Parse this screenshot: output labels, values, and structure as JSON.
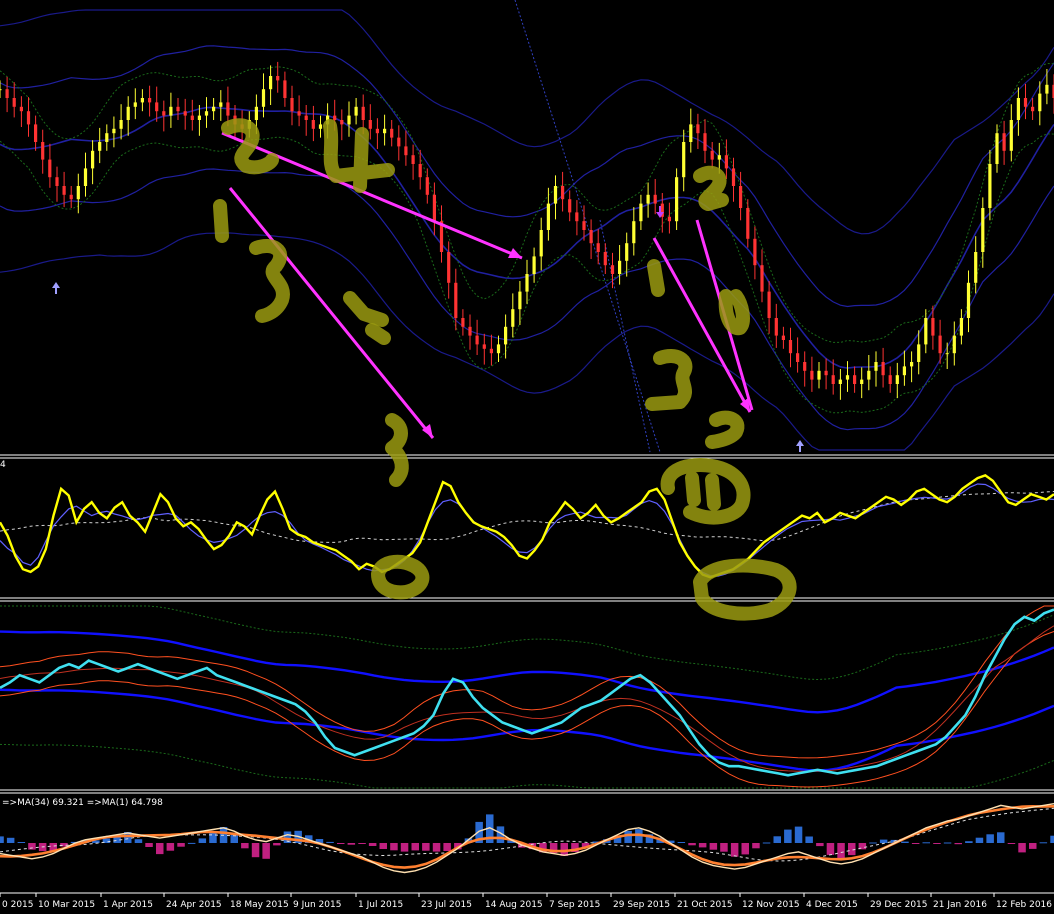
{
  "chart_data": {
    "type": "candlestick",
    "x_ticks": [
      "0 2015",
      "10 Mar 2015",
      "1 Apr 2015",
      "24 Apr 2015",
      "18 May 2015",
      "9 Jun 2015",
      "1 Jul 2015",
      "23 Jul 2015",
      "14 Aug 2015",
      "7 Sep 2015",
      "29 Sep 2015",
      "21 Oct 2015",
      "12 Nov 2015",
      "4 Dec 2015",
      "29 Dec 2015",
      "21 Jan 2016",
      "12 Feb 2016"
    ],
    "pane3_label_prefix": "4",
    "pane5_label": "=>MA(34) 69.321  =>MA(1) 64.798",
    "price_close": [
      0.82,
      0.8,
      0.78,
      0.77,
      0.74,
      0.7,
      0.66,
      0.62,
      0.6,
      0.58,
      0.57,
      0.6,
      0.64,
      0.68,
      0.7,
      0.72,
      0.73,
      0.75,
      0.78,
      0.79,
      0.8,
      0.79,
      0.77,
      0.76,
      0.78,
      0.77,
      0.76,
      0.75,
      0.76,
      0.77,
      0.78,
      0.79,
      0.76,
      0.74,
      0.73,
      0.75,
      0.78,
      0.82,
      0.85,
      0.84,
      0.8,
      0.77,
      0.76,
      0.75,
      0.73,
      0.74,
      0.76,
      0.75,
      0.74,
      0.76,
      0.78,
      0.75,
      0.73,
      0.72,
      0.73,
      0.71,
      0.69,
      0.67,
      0.65,
      0.62,
      0.58,
      0.52,
      0.45,
      0.38,
      0.3,
      0.28,
      0.26,
      0.24,
      0.23,
      0.22,
      0.24,
      0.28,
      0.32,
      0.36,
      0.4,
      0.44,
      0.5,
      0.56,
      0.6,
      0.57,
      0.54,
      0.52,
      0.5,
      0.47,
      0.45,
      0.42,
      0.4,
      0.43,
      0.47,
      0.52,
      0.56,
      0.58,
      0.56,
      0.53,
      0.52,
      0.62,
      0.7,
      0.74,
      0.72,
      0.68,
      0.66,
      0.67,
      0.64,
      0.6,
      0.55,
      0.48,
      0.42,
      0.36,
      0.3,
      0.26,
      0.25,
      0.22,
      0.2,
      0.18,
      0.16,
      0.18,
      0.17,
      0.15,
      0.16,
      0.17,
      0.15,
      0.16,
      0.18,
      0.2,
      0.17,
      0.15,
      0.17,
      0.19,
      0.2,
      0.24,
      0.3,
      0.26,
      0.22,
      0.22,
      0.26,
      0.3,
      0.38,
      0.45,
      0.55,
      0.65,
      0.72,
      0.68,
      0.75,
      0.8,
      0.78,
      0.77,
      0.81,
      0.83,
      0.8
    ],
    "rsi_values": [
      0.55,
      0.45,
      0.3,
      0.2,
      0.18,
      0.22,
      0.35,
      0.6,
      0.8,
      0.75,
      0.55,
      0.65,
      0.7,
      0.62,
      0.58,
      0.66,
      0.7,
      0.6,
      0.55,
      0.48,
      0.62,
      0.76,
      0.7,
      0.58,
      0.52,
      0.55,
      0.5,
      0.42,
      0.35,
      0.38,
      0.45,
      0.55,
      0.52,
      0.46,
      0.6,
      0.72,
      0.78,
      0.65,
      0.5,
      0.46,
      0.44,
      0.4,
      0.38,
      0.36,
      0.34,
      0.3,
      0.26,
      0.2,
      0.24,
      0.22,
      0.18,
      0.2,
      0.24,
      0.28,
      0.32,
      0.4,
      0.55,
      0.7,
      0.85,
      0.82,
      0.7,
      0.62,
      0.55,
      0.52,
      0.5,
      0.48,
      0.44,
      0.38,
      0.3,
      0.28,
      0.34,
      0.42,
      0.55,
      0.62,
      0.7,
      0.65,
      0.58,
      0.62,
      0.68,
      0.6,
      0.55,
      0.58,
      0.62,
      0.66,
      0.7,
      0.78,
      0.8,
      0.72,
      0.56,
      0.4,
      0.3,
      0.22,
      0.16,
      0.14,
      0.16,
      0.18,
      0.2,
      0.24,
      0.28,
      0.34,
      0.4,
      0.44,
      0.48,
      0.52,
      0.56,
      0.6,
      0.58,
      0.62,
      0.55,
      0.58,
      0.62,
      0.6,
      0.58,
      0.62,
      0.66,
      0.7,
      0.74,
      0.72,
      0.68,
      0.72,
      0.78,
      0.8,
      0.76,
      0.72,
      0.7,
      0.74,
      0.8,
      0.84,
      0.88,
      0.9,
      0.86,
      0.78,
      0.7,
      0.68,
      0.72,
      0.76,
      0.74,
      0.72,
      0.76
    ],
    "pane3_values": [
      0.55,
      0.58,
      0.62,
      0.6,
      0.58,
      0.62,
      0.66,
      0.68,
      0.66,
      0.7,
      0.68,
      0.66,
      0.64,
      0.66,
      0.68,
      0.66,
      0.64,
      0.62,
      0.6,
      0.62,
      0.64,
      0.66,
      0.62,
      0.6,
      0.58,
      0.56,
      0.54,
      0.52,
      0.5,
      0.48,
      0.46,
      0.42,
      0.36,
      0.28,
      0.22,
      0.2,
      0.18,
      0.2,
      0.22,
      0.24,
      0.26,
      0.28,
      0.3,
      0.34,
      0.4,
      0.52,
      0.6,
      0.58,
      0.5,
      0.44,
      0.4,
      0.36,
      0.34,
      0.32,
      0.3,
      0.32,
      0.34,
      0.36,
      0.4,
      0.44,
      0.46,
      0.48,
      0.52,
      0.56,
      0.6,
      0.62,
      0.58,
      0.52,
      0.46,
      0.4,
      0.32,
      0.24,
      0.18,
      0.14,
      0.12,
      0.12,
      0.11,
      0.1,
      0.09,
      0.08,
      0.07,
      0.08,
      0.09,
      0.1,
      0.09,
      0.08,
      0.09,
      0.1,
      0.11,
      0.12,
      0.14,
      0.16,
      0.18,
      0.2,
      0.22,
      0.24,
      0.28,
      0.34,
      0.4,
      0.5,
      0.62,
      0.72,
      0.82,
      0.9,
      0.94,
      0.92,
      0.96,
      0.98
    ],
    "pane5_values": [
      0.4,
      0.38,
      0.36,
      0.34,
      0.36,
      0.4,
      0.46,
      0.52,
      0.56,
      0.58,
      0.6,
      0.62,
      0.64,
      0.62,
      0.6,
      0.58,
      0.6,
      0.62,
      0.64,
      0.66,
      0.68,
      0.7,
      0.66,
      0.6,
      0.56,
      0.54,
      0.58,
      0.62,
      0.6,
      0.56,
      0.52,
      0.48,
      0.44,
      0.4,
      0.36,
      0.3,
      0.24,
      0.2,
      0.18,
      0.2,
      0.24,
      0.3,
      0.38,
      0.46,
      0.56,
      0.66,
      0.7,
      0.64,
      0.56,
      0.5,
      0.46,
      0.42,
      0.4,
      0.38,
      0.4,
      0.44,
      0.5,
      0.56,
      0.62,
      0.68,
      0.7,
      0.66,
      0.6,
      0.52,
      0.44,
      0.36,
      0.3,
      0.26,
      0.24,
      0.22,
      0.24,
      0.28,
      0.32,
      0.36,
      0.4,
      0.42,
      0.38,
      0.34,
      0.3,
      0.28,
      0.3,
      0.34,
      0.4,
      0.46,
      0.52,
      0.58,
      0.64,
      0.7,
      0.74,
      0.78,
      0.8,
      0.84,
      0.88,
      0.92,
      0.96,
      0.94,
      0.92,
      0.94,
      0.96,
      0.98
    ],
    "colors": {
      "background": "#000000",
      "bull_candle": "#ffff33",
      "bear_candle": "#ff3333",
      "band_main": "#2020a0",
      "band_outer": "#1a1a8a",
      "band_green": "#1a6a1a",
      "rsi_line": "#ffff00",
      "rsi_signal": "#6060ff",
      "pane3_line": "#40e0f0",
      "pane3_bands": "#ff5020",
      "pane3_blue": "#1010ff",
      "hist_pos": "#2a6ad0",
      "hist_neg": "#c02080",
      "pane5_line": "#ffe0b0",
      "pane5_signal": "#ff8030",
      "arrow": "#ff33ff",
      "scribble": "#9a9a10"
    }
  }
}
